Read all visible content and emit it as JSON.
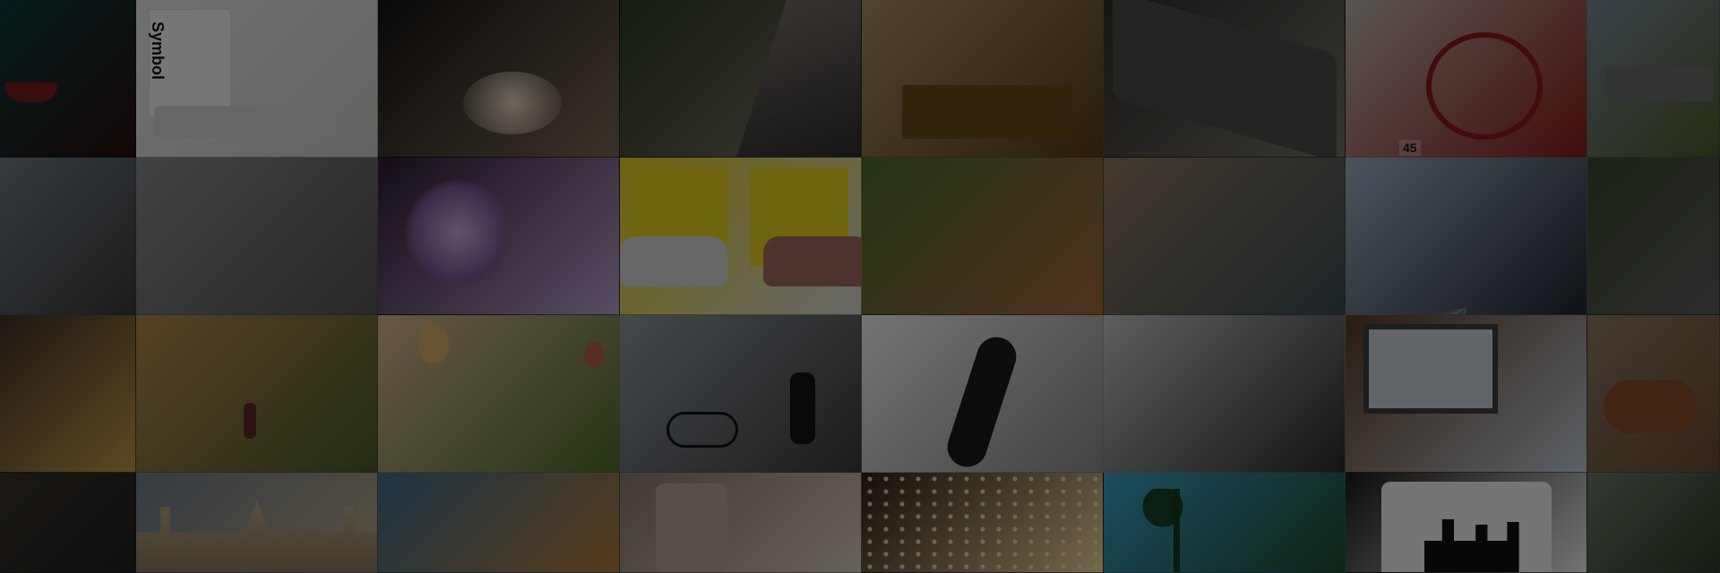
{
  "page": {
    "overlay_color": "#000000",
    "overlay_opacity": 0.52
  },
  "tiles": [
    {
      "subject": "red-boat-teal-water",
      "colors": [
        "#0e3b3c",
        "#2a0d0d"
      ]
    },
    {
      "subject": "symbol-notebook-laptop",
      "colors": [
        "#e9e9e9",
        "#cfcfcf"
      ],
      "label": "Symbol"
    },
    {
      "subject": "concert-crowd-silhouette",
      "colors": [
        "#151210",
        "#7a6a55"
      ]
    },
    {
      "subject": "forest-rock-cliff",
      "colors": [
        "#2b3a22",
        "#7d7268"
      ]
    },
    {
      "subject": "couple-on-bench",
      "colors": [
        "#a68d6a",
        "#5a3c17"
      ]
    },
    {
      "subject": "guitar-effects-pedals",
      "colors": [
        "#2d2d2b",
        "#767066"
      ]
    },
    {
      "subject": "red-tricycle",
      "colors": [
        "#b9b4aa",
        "#8a1a1a"
      ],
      "label": "45"
    },
    {
      "subject": "castle-landscape",
      "colors": [
        "#7a8898",
        "#4d5c2b"
      ]
    },
    {
      "subject": "seaside-promenade",
      "colors": [
        "#6f7a85",
        "#3a3a3a"
      ]
    },
    {
      "subject": "misty-beach",
      "colors": [
        "#8b8b8b",
        "#535353"
      ]
    },
    {
      "subject": "purple-petunia",
      "colors": [
        "#2d1a33",
        "#b9a2cc"
      ]
    },
    {
      "subject": "two-vintage-cars-yellow-doors",
      "colors": [
        "#e5cf1e",
        "#d8d8d8"
      ]
    },
    {
      "subject": "cafe-terrace",
      "colors": [
        "#4c6b2f",
        "#a56a3c"
      ]
    },
    {
      "subject": "canal-town",
      "colors": [
        "#8d7660",
        "#3b4d54"
      ]
    },
    {
      "subject": "stage-light-beams",
      "colors": [
        "#9fb0c2",
        "#1e2630"
      ]
    },
    {
      "subject": "rocks-on-grass",
      "colors": [
        "#3a4a2e",
        "#5c5c5c"
      ]
    },
    {
      "subject": "rainy-window-lights",
      "colors": [
        "#3c3226",
        "#c39a48"
      ]
    },
    {
      "subject": "runner-in-field",
      "colors": [
        "#b28a4d",
        "#4a5a2a"
      ]
    },
    {
      "subject": "hot-air-balloons",
      "colors": [
        "#d6b891",
        "#4f6d2c"
      ]
    },
    {
      "subject": "man-and-bicycle-lakeside",
      "colors": [
        "#8d98a3",
        "#3c3a3a"
      ]
    },
    {
      "subject": "skateboard-and-tripod",
      "colors": [
        "#f2f2f2",
        "#8a8a8a"
      ]
    },
    {
      "subject": "cafe-interior-silhouettes",
      "colors": [
        "#bfc3c6",
        "#2a2a2a"
      ]
    },
    {
      "subject": "laptop-on-desk",
      "colors": [
        "#5a3a22",
        "#bfcad5"
      ]
    },
    {
      "subject": "highland-cow",
      "colors": [
        "#8c7a62",
        "#6b4a33"
      ]
    },
    {
      "subject": "dark-interior",
      "colors": [
        "#3b332a",
        "#202020"
      ]
    },
    {
      "subject": "gothic-cathedral",
      "colors": [
        "#6f7c8b",
        "#b8a684"
      ]
    },
    {
      "subject": "ornate-boat",
      "colors": [
        "#3f6f8c",
        "#b27a3a"
      ]
    },
    {
      "subject": "coffee-cup",
      "colors": [
        "#8b7b6e",
        "#d7cbbd"
      ]
    },
    {
      "subject": "string-lights-street",
      "colors": [
        "#2a2016",
        "#f3d9a0"
      ]
    },
    {
      "subject": "palm-trees-beach",
      "colors": [
        "#3aa1c9",
        "#1f4a2b"
      ]
    },
    {
      "subject": "cave-silhouettes",
      "colors": [
        "#1a1a1a",
        "#f0f0f0"
      ]
    },
    {
      "subject": "foggy-green-field",
      "colors": [
        "#6e7a68",
        "#2c3a25"
      ]
    }
  ]
}
